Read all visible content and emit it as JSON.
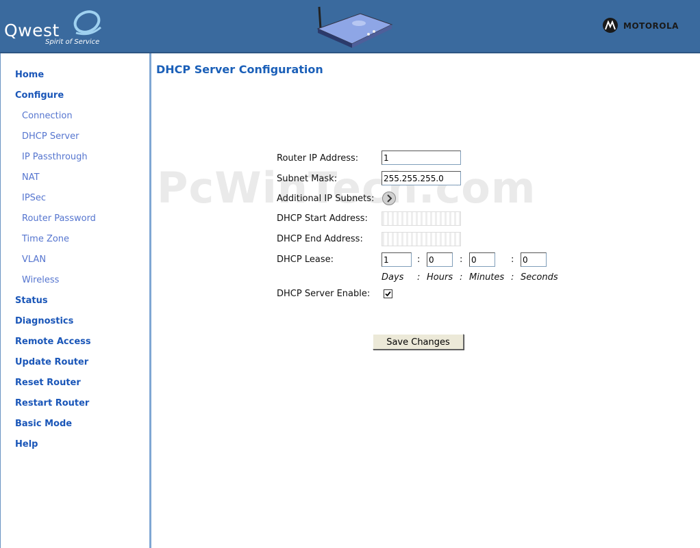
{
  "header": {
    "brand_left": "Qwest",
    "brand_tagline": "Spirit of Service",
    "brand_right": "MOTOROLA",
    "colors": {
      "header_bg": "#3a6a9e",
      "nav_main": "#1a56b8",
      "nav_sub": "#5575cf"
    }
  },
  "sidebar": {
    "items": [
      {
        "label": "Home",
        "level": "main"
      },
      {
        "label": "Configure",
        "level": "main"
      },
      {
        "label": "Connection",
        "level": "sub"
      },
      {
        "label": "DHCP Server",
        "level": "sub"
      },
      {
        "label": "IP Passthrough",
        "level": "sub"
      },
      {
        "label": "NAT",
        "level": "sub"
      },
      {
        "label": "IPSec",
        "level": "sub"
      },
      {
        "label": "Router Password",
        "level": "sub"
      },
      {
        "label": "Time Zone",
        "level": "sub"
      },
      {
        "label": "VLAN",
        "level": "sub"
      },
      {
        "label": "Wireless",
        "level": "sub"
      },
      {
        "label": "Status",
        "level": "main"
      },
      {
        "label": "Diagnostics",
        "level": "main"
      },
      {
        "label": "Remote Access",
        "level": "main"
      },
      {
        "label": "Update Router",
        "level": "main"
      },
      {
        "label": "Reset Router",
        "level": "main"
      },
      {
        "label": "Restart Router",
        "level": "main"
      },
      {
        "label": "Basic Mode",
        "level": "main"
      },
      {
        "label": "Help",
        "level": "main"
      }
    ]
  },
  "main": {
    "title": "DHCP Server Configuration",
    "watermark": "PcWinTech.com",
    "form": {
      "router_ip_label": "Router IP Address:",
      "router_ip_value": "1",
      "subnet_mask_label": "Subnet Mask:",
      "subnet_mask_value": "255.255.255.0",
      "additional_subnets_label": "Additional IP Subnets:",
      "dhcp_start_label": "DHCP Start Address:",
      "dhcp_start_value": "",
      "dhcp_end_label": "DHCP End Address:",
      "dhcp_end_value": "",
      "lease_label": "DHCP Lease:",
      "lease_days": "1",
      "lease_hours": "0",
      "lease_minutes": "0",
      "lease_seconds": "0",
      "unit_days": "Days",
      "unit_hours": "Hours",
      "unit_minutes": "Minutes",
      "unit_seconds": "Seconds",
      "separator": ":",
      "enable_label": "DHCP Server Enable:",
      "enable_checked": true,
      "save_label": "Save Changes"
    }
  }
}
